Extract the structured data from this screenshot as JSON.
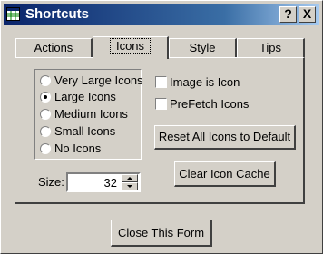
{
  "window": {
    "title": "Shortcuts"
  },
  "titlebar_buttons": {
    "help": "?",
    "close": "X"
  },
  "tabs": [
    {
      "label": "Actions",
      "active": false
    },
    {
      "label": "Icons",
      "active": true
    },
    {
      "label": "Style",
      "active": false
    },
    {
      "label": "Tips",
      "active": false
    }
  ],
  "icon_size_options": [
    {
      "label": "Very Large Icons",
      "selected": false
    },
    {
      "label": "Large Icons",
      "selected": true
    },
    {
      "label": "Medium Icons",
      "selected": false
    },
    {
      "label": "Small Icons",
      "selected": false
    },
    {
      "label": "No Icons",
      "selected": false
    }
  ],
  "checkboxes": {
    "image_is_icon": {
      "label": "Image is Icon",
      "checked": false
    },
    "prefetch_icons": {
      "label": "PreFetch Icons",
      "checked": false
    }
  },
  "buttons": {
    "reset_icons": "Reset All Icons to Default",
    "clear_cache": "Clear Icon Cache",
    "close_form": "Close This Form"
  },
  "size": {
    "label": "Size:",
    "value": "32"
  },
  "colors": {
    "titlebar_start": "#0a246a",
    "titlebar_end": "#a6caf0",
    "face": "#d4d0c8"
  }
}
